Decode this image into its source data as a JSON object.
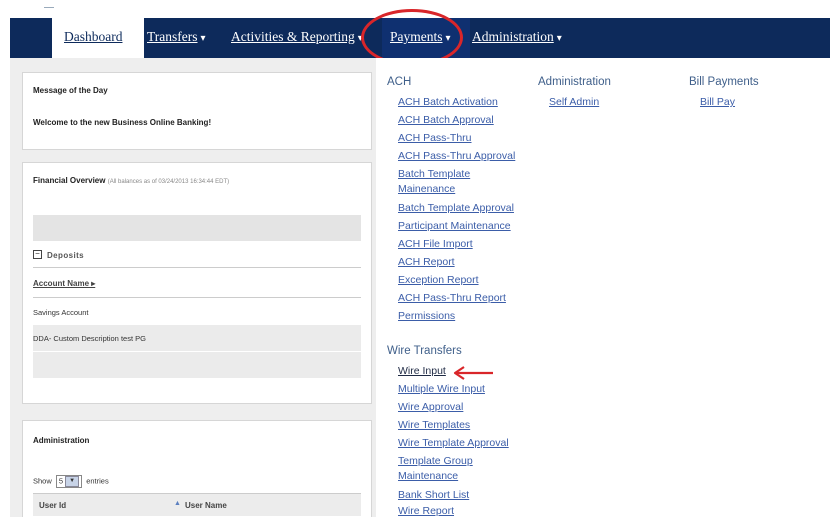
{
  "nav": {
    "dashboard": "Dashboard",
    "transfers": "Transfers",
    "activities": "Activities & Reporting",
    "payments": "Payments",
    "administration": "Administration",
    "chevron": "❯"
  },
  "dashboard": {
    "motd_title": "Message of the Day",
    "motd_text": "Welcome to the new Business Online Banking!",
    "financial_title": "Financial Overview",
    "financial_subtitle": "(All balances as of 03/24/2013 16:34:44 EDT)",
    "deposits_toggle": "−",
    "deposits_label": "Deposits",
    "account_name_header": "Account Name ▸",
    "accounts": [
      "Savings Account",
      "DDA- Custom Description test PG"
    ],
    "admin_title": "Administration",
    "show_label": "Show",
    "show_value": "5",
    "entries_label": "entries",
    "user_id_header": "User Id",
    "user_name_header": "User Name"
  },
  "payments_menu": {
    "ach_heading": "ACH",
    "ach_links": [
      "ACH Batch Activation",
      "ACH Batch Approval",
      "ACH Pass-Thru",
      "ACH Pass-Thru Approval",
      "Batch Template",
      "Mainenance",
      "Batch Template Approval",
      "Participant Maintenance",
      "ACH File Import",
      "ACH Report",
      "Exception Report",
      "ACH Pass-Thru Report",
      "Permissions"
    ],
    "wire_heading": "Wire Transfers",
    "wire_links": [
      "Wire Input",
      "Multiple Wire Input",
      "Wire Approval",
      "Wire Templates",
      "Wire Template Approval",
      "Template Group",
      "Maintenance",
      "Bank Short List",
      "Wire Report"
    ],
    "admin_heading": "Administration",
    "admin_links": [
      "Self Admin"
    ],
    "bill_heading": "Bill Payments",
    "bill_links": [
      "Bill Pay"
    ]
  },
  "colors": {
    "nav_bg": "#0d2a5b",
    "link": "#3b5da8",
    "highlight_ring": "#d9262a"
  }
}
